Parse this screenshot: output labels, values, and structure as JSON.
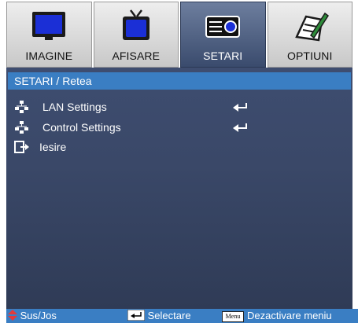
{
  "tabs": [
    {
      "label": "IMAGINE",
      "icon": "monitor-icon",
      "active": false
    },
    {
      "label": "AFISARE",
      "icon": "tv-icon",
      "active": false
    },
    {
      "label": "SETARI",
      "icon": "projector-icon",
      "active": true
    },
    {
      "label": "OPTIUNI",
      "icon": "pen-paper-icon",
      "active": false
    }
  ],
  "panel": {
    "title": "SETARI / Retea",
    "items": [
      {
        "label": "LAN Settings",
        "icon": "network-icon",
        "action_icon": "enter-icon"
      },
      {
        "label": "Control Settings",
        "icon": "network-icon",
        "action_icon": "enter-icon"
      },
      {
        "label": "Iesire",
        "icon": "exit-icon"
      }
    ]
  },
  "statusbar": {
    "updown_label": "Sus/Jos",
    "select_label": "Selectare",
    "menu_key": "Menu",
    "exit_label": "Dezactivare meniu"
  },
  "colors": {
    "accent_blue": "#3a7ec3",
    "panel_bg": "#3a4868",
    "active_tab": "#4a5b7d",
    "updown_arrow": "#e23a3a"
  }
}
